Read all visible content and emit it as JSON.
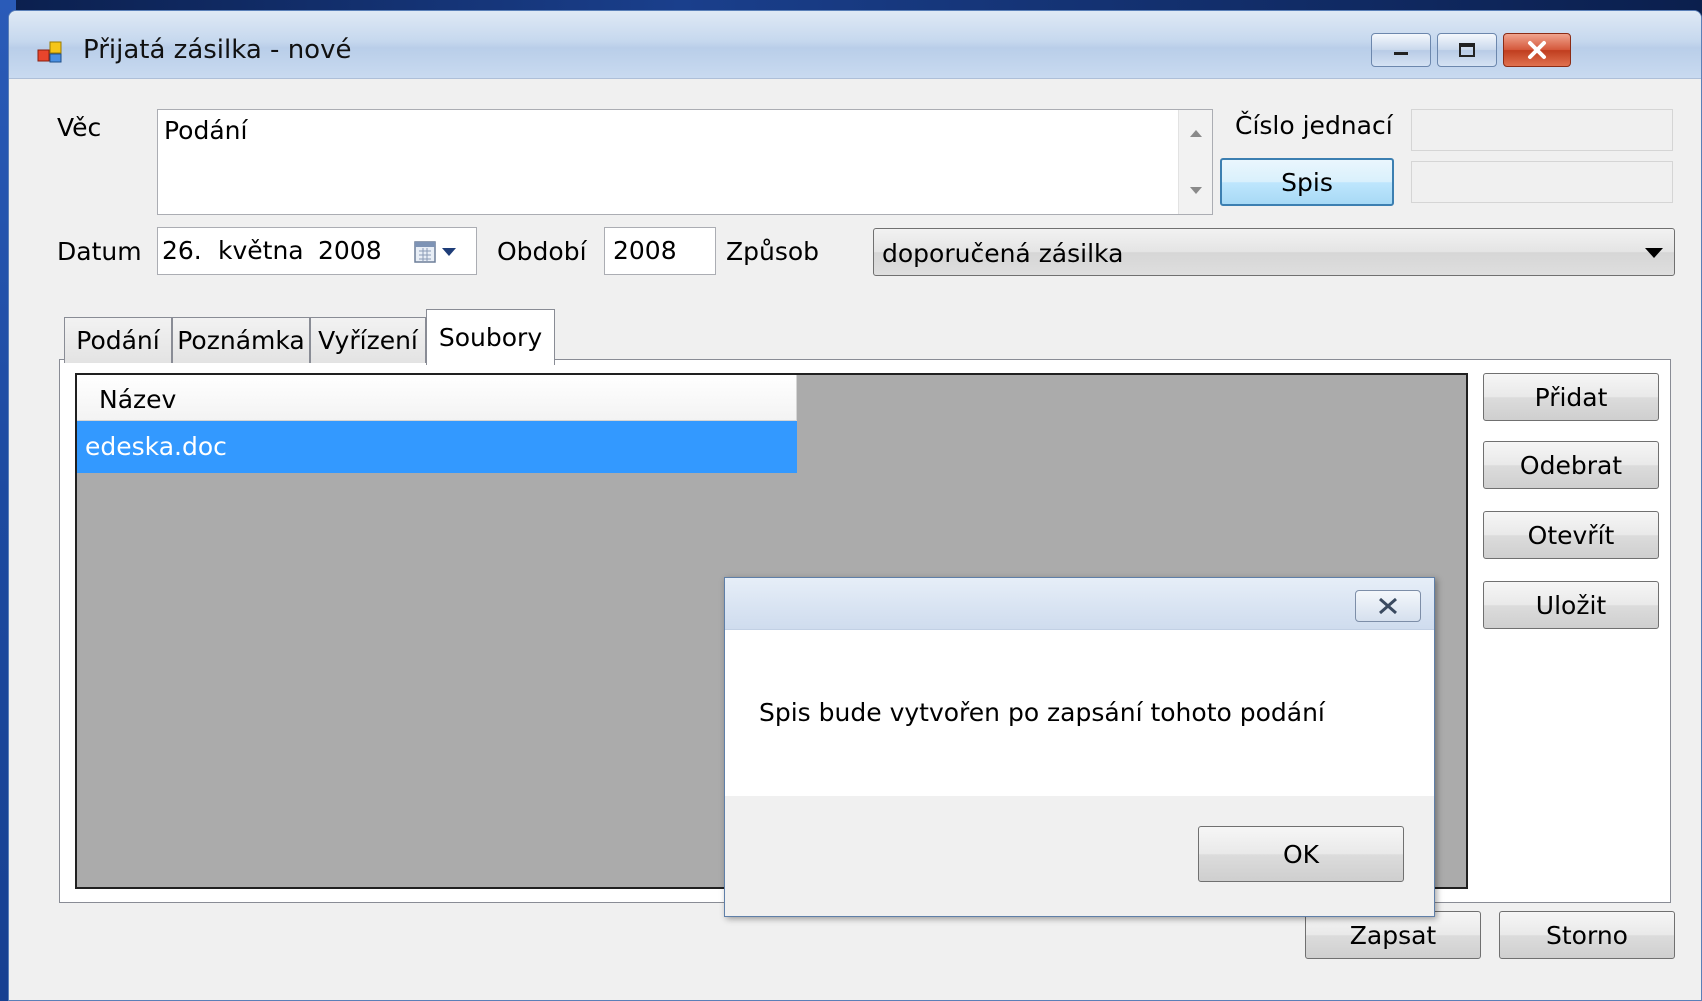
{
  "window": {
    "title": "Přijatá zásilka - nové",
    "app_icon": "app-window-icon",
    "controls": {
      "minimize_icon": "minimize-icon",
      "maximize_icon": "maximize-icon",
      "close_icon": "close-icon"
    }
  },
  "form": {
    "vec_label": "Věc",
    "vec_value": "Podání",
    "cislo_jednaci_label": "Číslo jednací",
    "cislo_jednaci_value": "",
    "spis_button": "Spis",
    "spis_value": "",
    "datum_label": "Datum",
    "datum_day": "26.",
    "datum_month": "května",
    "datum_year": "2008",
    "obdobi_label": "Období",
    "obdobi_value": "2008",
    "zpusob_label": "Způsob",
    "zpusob_value": "doporučená zásilka"
  },
  "tabs": [
    {
      "label": "Podání",
      "active": false
    },
    {
      "label": "Poznámka",
      "active": false
    },
    {
      "label": "Vyřízení",
      "active": false
    },
    {
      "label": "Soubory",
      "active": true
    }
  ],
  "files": {
    "column_header": "Název",
    "rows": [
      {
        "name": "edeska.doc",
        "selected": true
      }
    ]
  },
  "side_buttons": {
    "add": "Přidat",
    "remove": "Odebrat",
    "open": "Otevřít",
    "save": "Uložit"
  },
  "bottom_buttons": {
    "submit": "Zapsat",
    "cancel": "Storno"
  },
  "dialog": {
    "message": "Spis bude vytvořen po zapsání tohoto podání",
    "ok_label": "OK"
  },
  "colors": {
    "selection": "#3399ff",
    "list_background": "#ababab",
    "titlebar": "#c6d8ee"
  }
}
